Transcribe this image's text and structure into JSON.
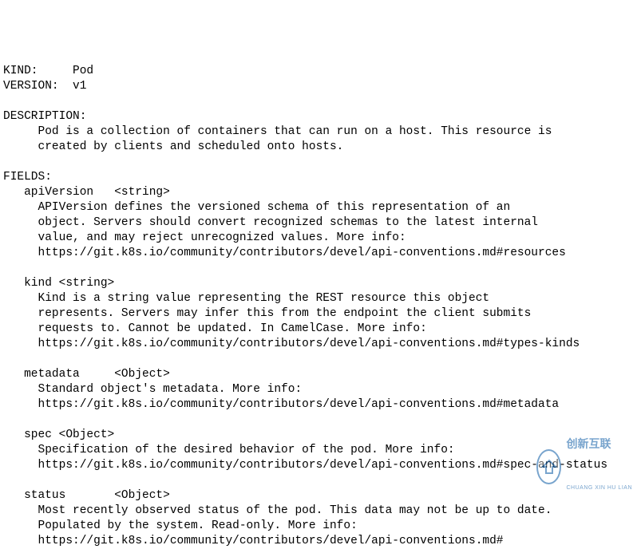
{
  "header": {
    "kind_label": "KIND:",
    "kind_value": "Pod",
    "version_label": "VERSION:",
    "version_value": "v1"
  },
  "description": {
    "label": "DESCRIPTION:",
    "text1": "     Pod is a collection of containers that can run on a host. This resource is",
    "text2": "     created by clients and scheduled onto hosts."
  },
  "fields_label": "FIELDS:",
  "fields": {
    "apiVersion": {
      "decl": "   apiVersion   <string>",
      "l1": "     APIVersion defines the versioned schema of this representation of an",
      "l2": "     object. Servers should convert recognized schemas to the latest internal",
      "l3": "     value, and may reject unrecognized values. More info:",
      "l4": "     https://git.k8s.io/community/contributors/devel/api-conventions.md#resources"
    },
    "kind": {
      "decl": "   kind <string>",
      "l1": "     Kind is a string value representing the REST resource this object",
      "l2": "     represents. Servers may infer this from the endpoint the client submits",
      "l3": "     requests to. Cannot be updated. In CamelCase. More info:",
      "l4": "     https://git.k8s.io/community/contributors/devel/api-conventions.md#types-kinds"
    },
    "metadata": {
      "decl": "   metadata     <Object>",
      "l1": "     Standard object's metadata. More info:",
      "l2": "     https://git.k8s.io/community/contributors/devel/api-conventions.md#metadata"
    },
    "spec": {
      "decl": "   spec <Object>",
      "l1": "     Specification of the desired behavior of the pod. More info:",
      "l2": "     https://git.k8s.io/community/contributors/devel/api-conventions.md#spec-and-status"
    },
    "status": {
      "decl": "   status       <Object>",
      "l1": "     Most recently observed status of the pod. This data may not be up to date.",
      "l2": "     Populated by the system. Read-only. More info:",
      "l3": "     https://git.k8s.io/community/contributors/devel/api-conventions.md#"
    }
  },
  "watermark": {
    "cn": "创新互联",
    "py": "CHUANG XIN HU LIAN"
  }
}
